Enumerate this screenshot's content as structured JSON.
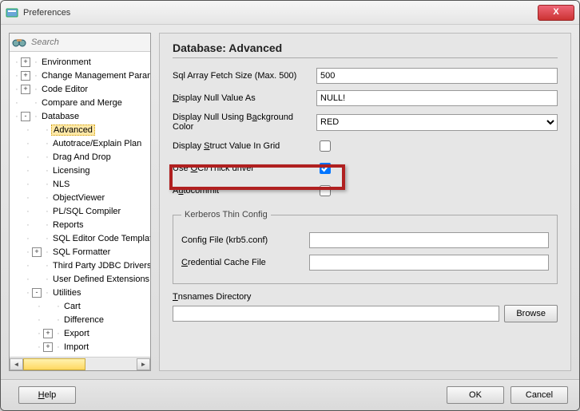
{
  "window": {
    "title": "Preferences"
  },
  "search": {
    "placeholder": "Search"
  },
  "tree": [
    {
      "depth": 0,
      "expander": "+",
      "label": "Environment"
    },
    {
      "depth": 0,
      "expander": "+",
      "label": "Change Management Parameters"
    },
    {
      "depth": 0,
      "expander": "+",
      "label": "Code Editor"
    },
    {
      "depth": 0,
      "expander": "",
      "label": "Compare and Merge"
    },
    {
      "depth": 0,
      "expander": "-",
      "label": "Database"
    },
    {
      "depth": 1,
      "expander": "",
      "label": "Advanced",
      "selected": true
    },
    {
      "depth": 1,
      "expander": "",
      "label": "Autotrace/Explain Plan"
    },
    {
      "depth": 1,
      "expander": "",
      "label": "Drag And Drop"
    },
    {
      "depth": 1,
      "expander": "",
      "label": "Licensing"
    },
    {
      "depth": 1,
      "expander": "",
      "label": "NLS"
    },
    {
      "depth": 1,
      "expander": "",
      "label": "ObjectViewer"
    },
    {
      "depth": 1,
      "expander": "",
      "label": "PL/SQL Compiler"
    },
    {
      "depth": 1,
      "expander": "",
      "label": "Reports"
    },
    {
      "depth": 1,
      "expander": "",
      "label": "SQL Editor Code Templates"
    },
    {
      "depth": 1,
      "expander": "+",
      "label": "SQL Formatter"
    },
    {
      "depth": 1,
      "expander": "",
      "label": "Third Party JDBC Drivers"
    },
    {
      "depth": 1,
      "expander": "",
      "label": "User Defined Extensions"
    },
    {
      "depth": 1,
      "expander": "-",
      "label": "Utilities"
    },
    {
      "depth": 2,
      "expander": "",
      "label": "Cart"
    },
    {
      "depth": 2,
      "expander": "",
      "label": "Difference"
    },
    {
      "depth": 2,
      "expander": "+",
      "label": "Export"
    },
    {
      "depth": 2,
      "expander": "+",
      "label": "Import"
    }
  ],
  "panel": {
    "heading": "Database: Advanced",
    "fetchSize": {
      "label": "Sql Array Fetch Size (Max. 500)",
      "value": "500"
    },
    "nullValue": {
      "label_pre": "D",
      "label_rest": "isplay Null Value As",
      "value": "NULL!"
    },
    "nullBg": {
      "label_pre": "Display Null Using B",
      "label_u": "a",
      "label_rest": "ckground Color",
      "value": "RED"
    },
    "structGrid": {
      "label_pre": "Display ",
      "label_u": "S",
      "label_rest": "truct Value In Grid",
      "checked": false
    },
    "oci": {
      "label_pre": "Use ",
      "label_u": "O",
      "label_rest": "CI/Thick driver",
      "checked": true
    },
    "autocommit": {
      "label_pre": "A",
      "label_u": "u",
      "label_rest": "tocommit",
      "checked": false
    },
    "kerberos": {
      "legend": "Kerberos Thin Config",
      "config": {
        "label_pre": "Confi",
        "label_u": "g",
        "label_rest": " File (krb5.conf)",
        "value": ""
      },
      "cred": {
        "label_u": "C",
        "label_rest": "redential Cache File",
        "value": ""
      }
    },
    "tns": {
      "label_u": "T",
      "label_rest": "nsnames Directory",
      "value": "",
      "browse": "Browse"
    }
  },
  "buttons": {
    "help": "Help",
    "ok": "OK",
    "cancel": "Cancel"
  },
  "closeX": "X"
}
